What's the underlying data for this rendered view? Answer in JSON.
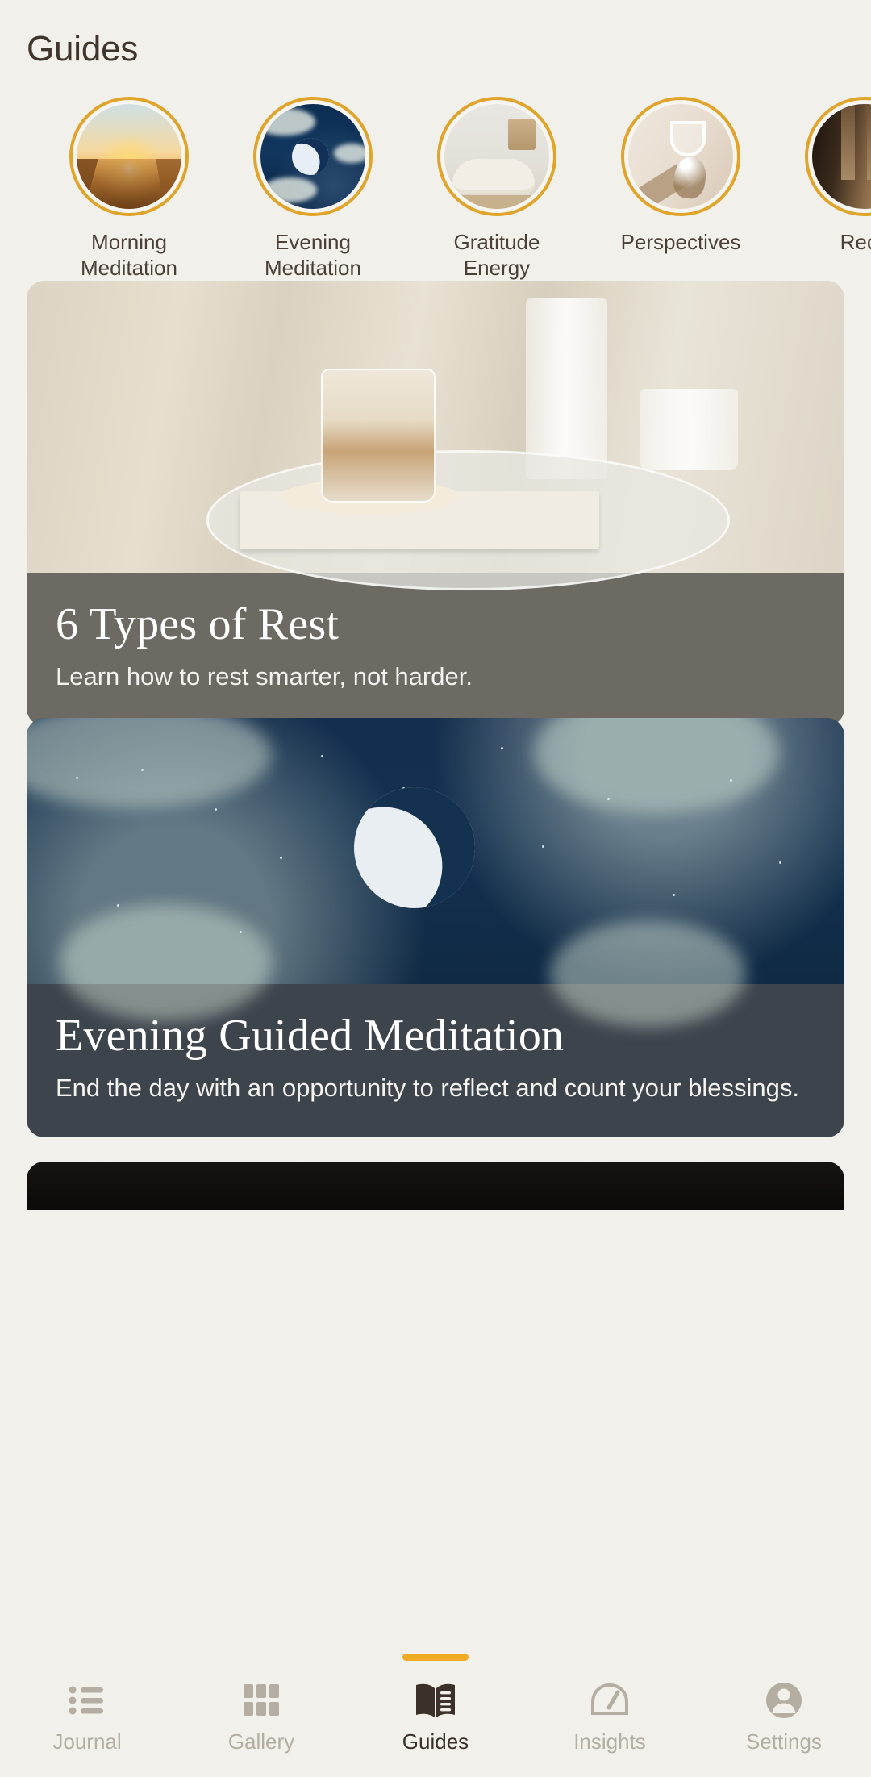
{
  "header": {
    "title": "Guides"
  },
  "categories": [
    {
      "label": "Morning\nMeditation",
      "icon": "sunrise-thumbnail"
    },
    {
      "label": "Evening\nMeditation",
      "icon": "night-sky-thumbnail"
    },
    {
      "label": "Gratitude\nEnergy",
      "icon": "living-room-thumbnail"
    },
    {
      "label": "Perspectives",
      "icon": "glassware-thumbnail"
    },
    {
      "label": "Reco",
      "icon": "archway-thumbnail"
    }
  ],
  "cards": [
    {
      "title": "6 Types of Rest",
      "subtitle": "Learn how to rest smarter, not harder.",
      "image": "coffee-glass-table-photo"
    },
    {
      "title": "Evening Guided Meditation",
      "subtitle": "End the day with an opportunity to reflect and count your blessings.",
      "image": "crescent-moon-night-sky-photo"
    }
  ],
  "tabs": [
    {
      "label": "Journal",
      "icon": "list-icon",
      "active": false
    },
    {
      "label": "Gallery",
      "icon": "grid-icon",
      "active": false
    },
    {
      "label": "Guides",
      "icon": "open-book-icon",
      "active": true
    },
    {
      "label": "Insights",
      "icon": "gauge-icon",
      "active": false
    },
    {
      "label": "Settings",
      "icon": "person-icon",
      "active": false
    }
  ],
  "colors": {
    "background": "#f2f0eb",
    "accent_gold": "#e0a42b",
    "indicator": "#f0ab24",
    "text_primary": "#3f352c",
    "text_muted": "#b3aea1",
    "card1_caption_bg": "#6c6a63",
    "card2_caption_bg": "#3d444c"
  }
}
